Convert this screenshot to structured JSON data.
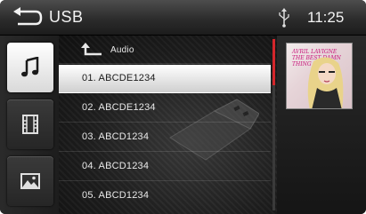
{
  "header": {
    "title": "USB",
    "time": "11:25"
  },
  "sidebar": {
    "items": [
      {
        "name": "music",
        "icon": "music-note-icon",
        "active": true
      },
      {
        "name": "video",
        "icon": "film-icon",
        "active": false
      },
      {
        "name": "photo",
        "icon": "picture-icon",
        "active": false
      }
    ]
  },
  "list": {
    "folder": "Audio",
    "items": [
      "01. ABCDE1234",
      "02. ABCDE1234",
      "03. ABCD1234",
      "04. ABCD1234",
      "05. ABCD1234"
    ],
    "selected_index": 0
  },
  "album": {
    "artist_text": "AVRIL LAVIGNE",
    "album_text": "THE BEST DAMN THING"
  },
  "colors": {
    "accent": "#d4262b",
    "header_bg": "#3a3a3a",
    "text": "#f2f2f2"
  }
}
